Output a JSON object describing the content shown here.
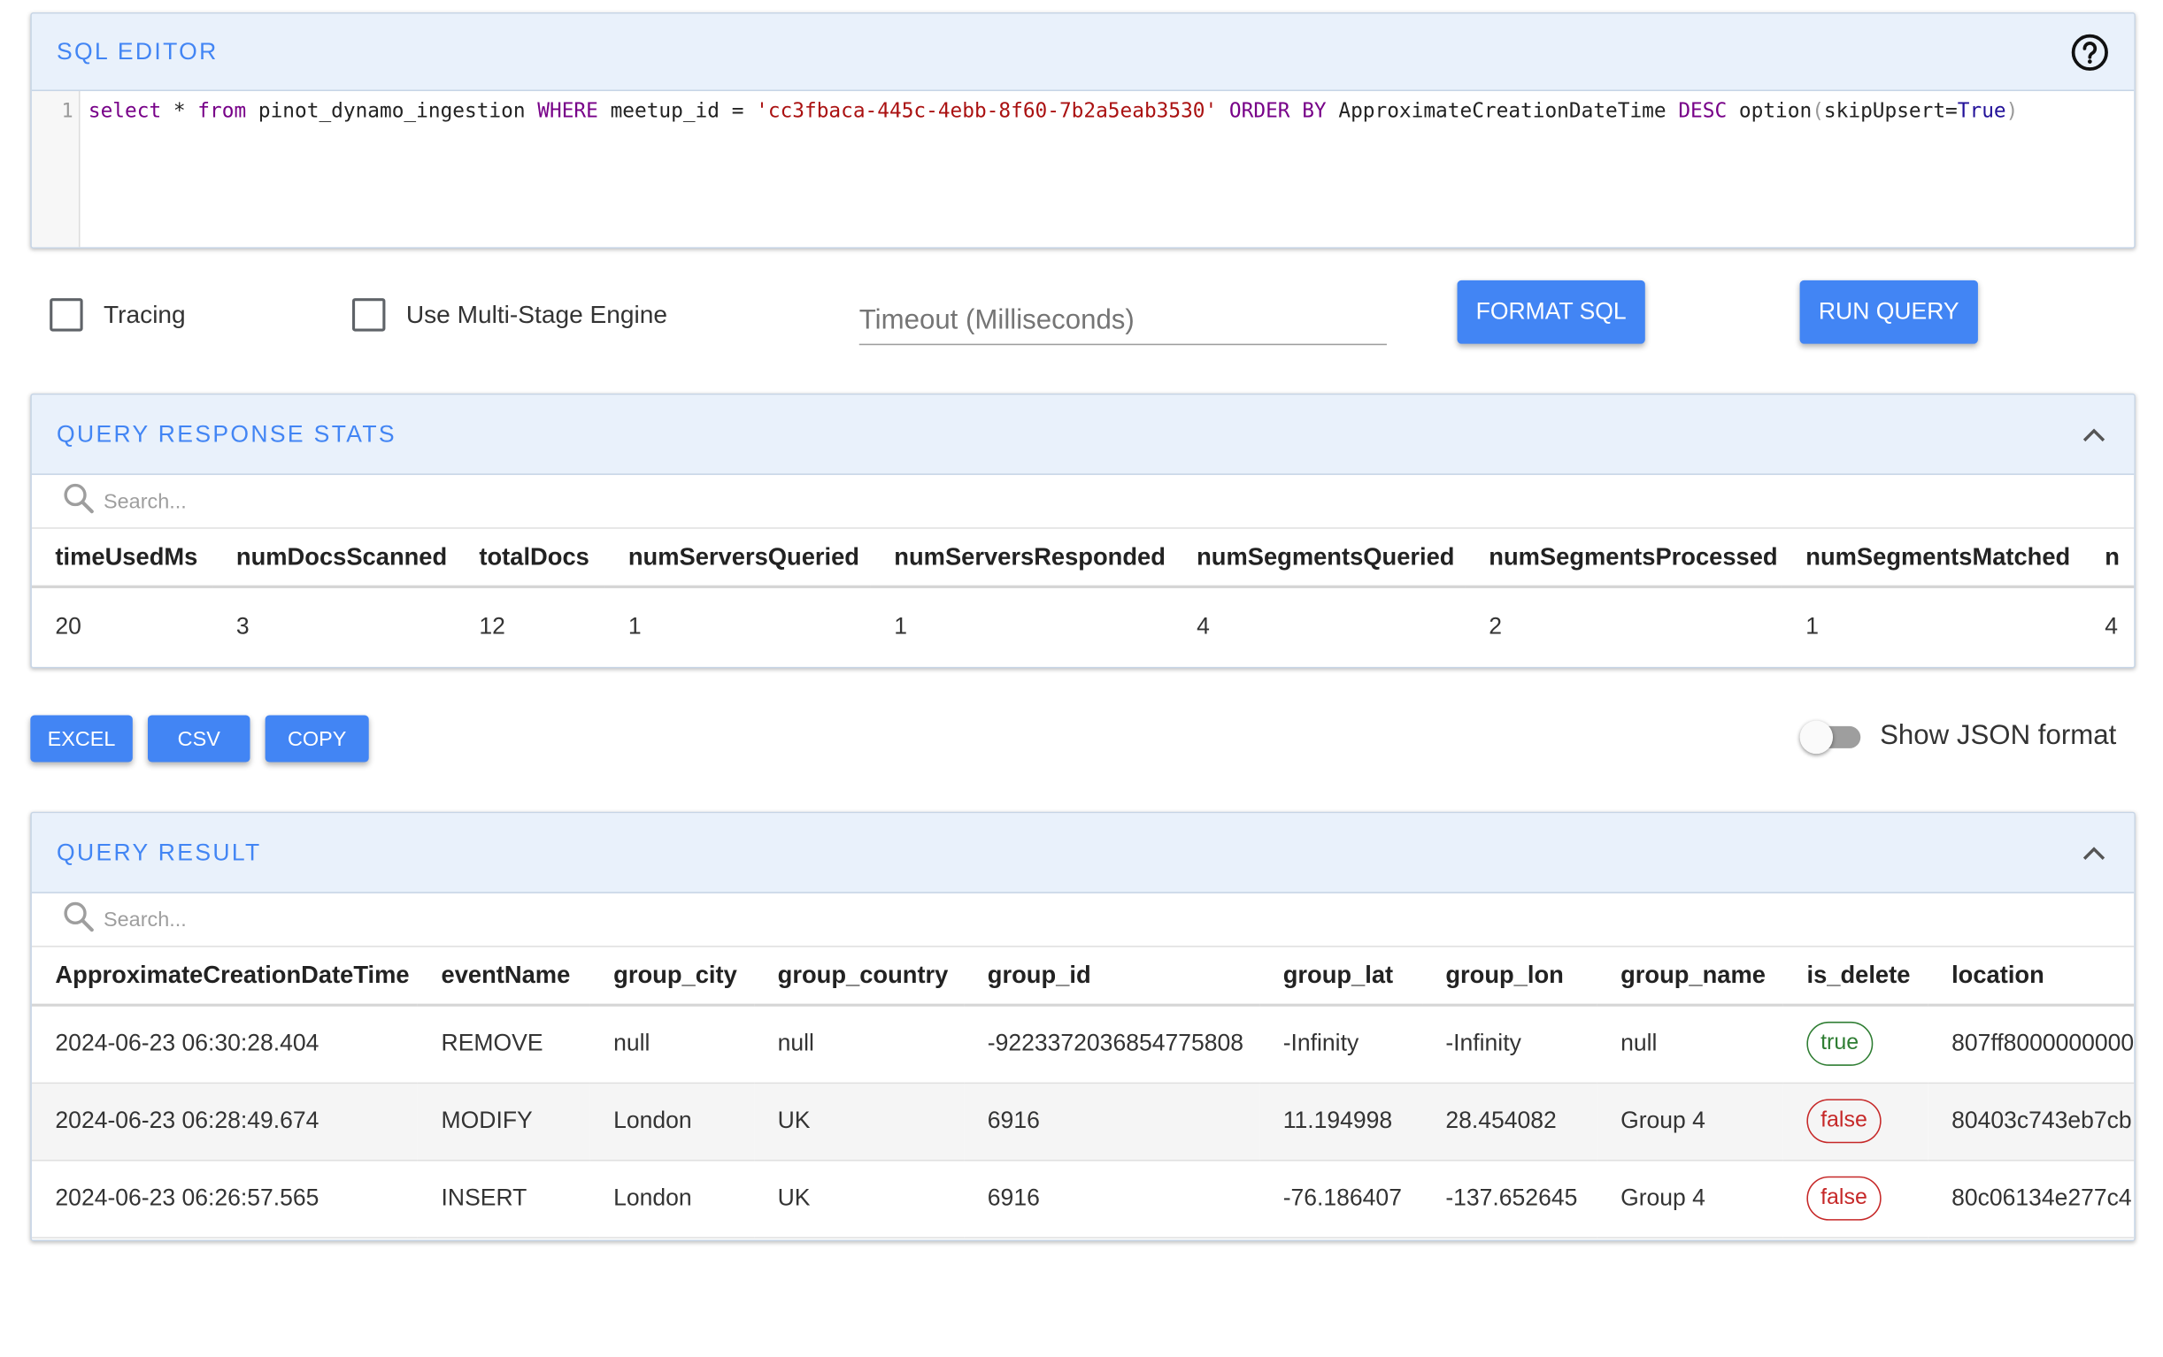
{
  "sql_editor": {
    "title": "SQL EDITOR",
    "help_icon": "help-circle-icon",
    "line_number": "1",
    "query": {
      "kw_select": "select",
      "star": " * ",
      "kw_from": "from",
      "table": " pinot_dynamo_ingestion ",
      "kw_where": "WHERE",
      "condition": " meetup_id = ",
      "str_value": "'cc3fbaca-445c-4ebb-8f60-7b2a5eab3530'",
      "kw_orderby": " ORDER BY",
      "order_col": " ApproximateCreationDateTime ",
      "kw_desc": "DESC",
      "option_fn": " option",
      "paren_open": "(",
      "option_body": "skipUpsert=",
      "atom_true": "True",
      "paren_close": ")"
    }
  },
  "controls": {
    "tracing_label": "Tracing",
    "multistage_label": "Use Multi-Stage Engine",
    "timeout_placeholder": "Timeout (Milliseconds)",
    "format_sql_label": "FORMAT SQL",
    "run_query_label": "RUN QUERY"
  },
  "stats": {
    "title": "QUERY RESPONSE STATS",
    "search_placeholder": "Search...",
    "columns": [
      "timeUsedMs",
      "numDocsScanned",
      "totalDocs",
      "numServersQueried",
      "numServersResponded",
      "numSegmentsQueried",
      "numSegmentsProcessed",
      "numSegmentsMatched",
      "n"
    ],
    "row": [
      "20",
      "3",
      "12",
      "1",
      "1",
      "4",
      "2",
      "1",
      "4"
    ]
  },
  "export": {
    "excel_label": "EXCEL",
    "csv_label": "CSV",
    "copy_label": "COPY",
    "json_toggle_label": "Show JSON format",
    "json_toggle_on": false
  },
  "result": {
    "title": "QUERY RESULT",
    "search_placeholder": "Search...",
    "columns": [
      "ApproximateCreationDateTime",
      "eventName",
      "group_city",
      "group_country",
      "group_id",
      "group_lat",
      "group_lon",
      "group_name",
      "is_delete",
      "location"
    ],
    "rows": [
      [
        "2024-06-23 06:30:28.404",
        "REMOVE",
        "null",
        "null",
        "-9223372036854775808",
        "-Infinity",
        "-Infinity",
        "null",
        "true",
        "807ff8000000000"
      ],
      [
        "2024-06-23 06:28:49.674",
        "MODIFY",
        "London",
        "UK",
        "6916",
        "11.194998",
        "28.454082",
        "Group 4",
        "false",
        "80403c743eb7cb"
      ],
      [
        "2024-06-23 06:26:57.565",
        "INSERT",
        "London",
        "UK",
        "6916",
        "-76.186407",
        "-137.652645",
        "Group 4",
        "false",
        "80c06134e277c4"
      ]
    ]
  },
  "colors": {
    "accent": "#4285f4",
    "panel_header_bg": "#e9f1fb",
    "true_chip": "#2e7d32",
    "false_chip": "#c62828"
  }
}
